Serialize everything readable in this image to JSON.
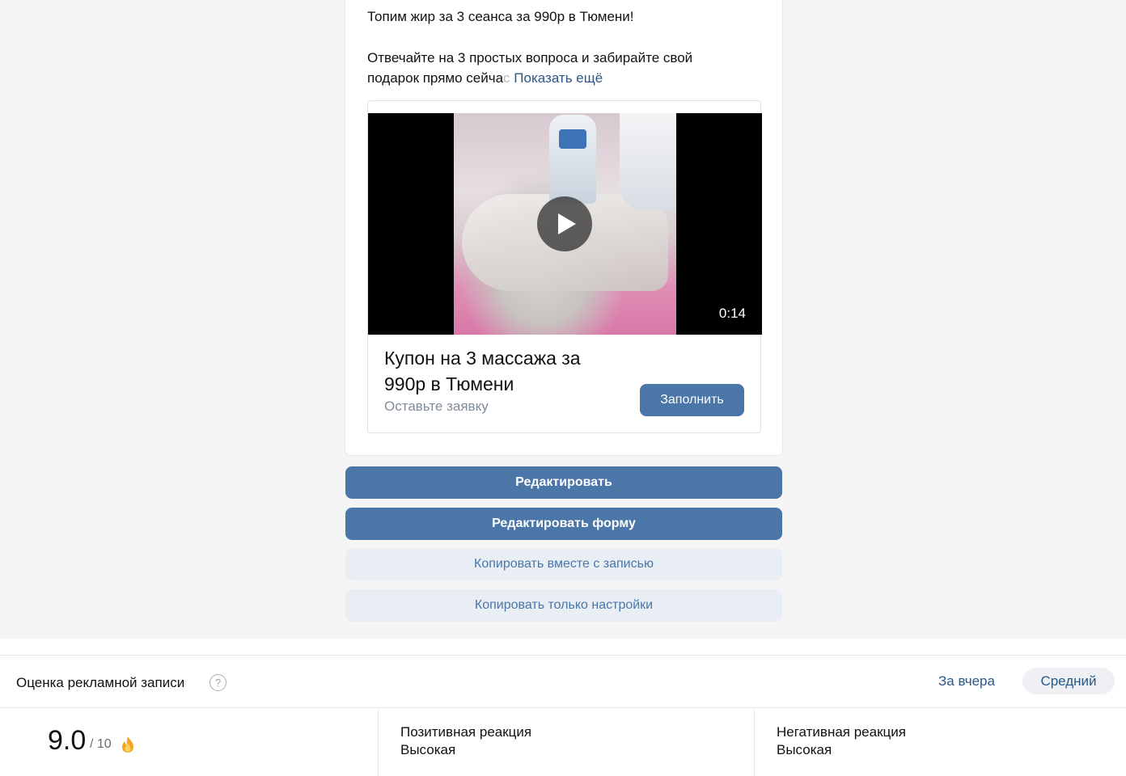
{
  "post": {
    "line1": "Топим жир за 3 сеанса за 990р в Тюмени!",
    "line2": "Отвечайте на 3 простых вопроса и забирайте свой",
    "line3_start": "подарок прямо сейча",
    "line3_faded": "с",
    "show_more": "Показать ещё"
  },
  "snippet": {
    "duration": "0:14",
    "title": "Купон на 3 массажа за 990р в Тюмени",
    "subtitle": "Оставьте заявку",
    "button": "Заполнить"
  },
  "actions": {
    "edit": "Редактировать",
    "edit_form": "Редактировать форму",
    "copy_with_post": "Копировать вместе с записью",
    "copy_settings": "Копировать только настройки"
  },
  "rating": {
    "title": "Оценка рекламной записи",
    "help": "?",
    "period_link": "За вчера",
    "period_chip": "Средний",
    "score": "9.0",
    "score_max": "/ 10",
    "score_icon": "fire-icon",
    "positive_label": "Позитивная реакция",
    "positive_value": "Высокая",
    "negative_label": "Негативная реакция",
    "negative_value": "Высокая"
  },
  "colors": {
    "accent": "#4a76a8",
    "link": "#2a5885",
    "secondary_button_bg": "#e9eef5"
  }
}
